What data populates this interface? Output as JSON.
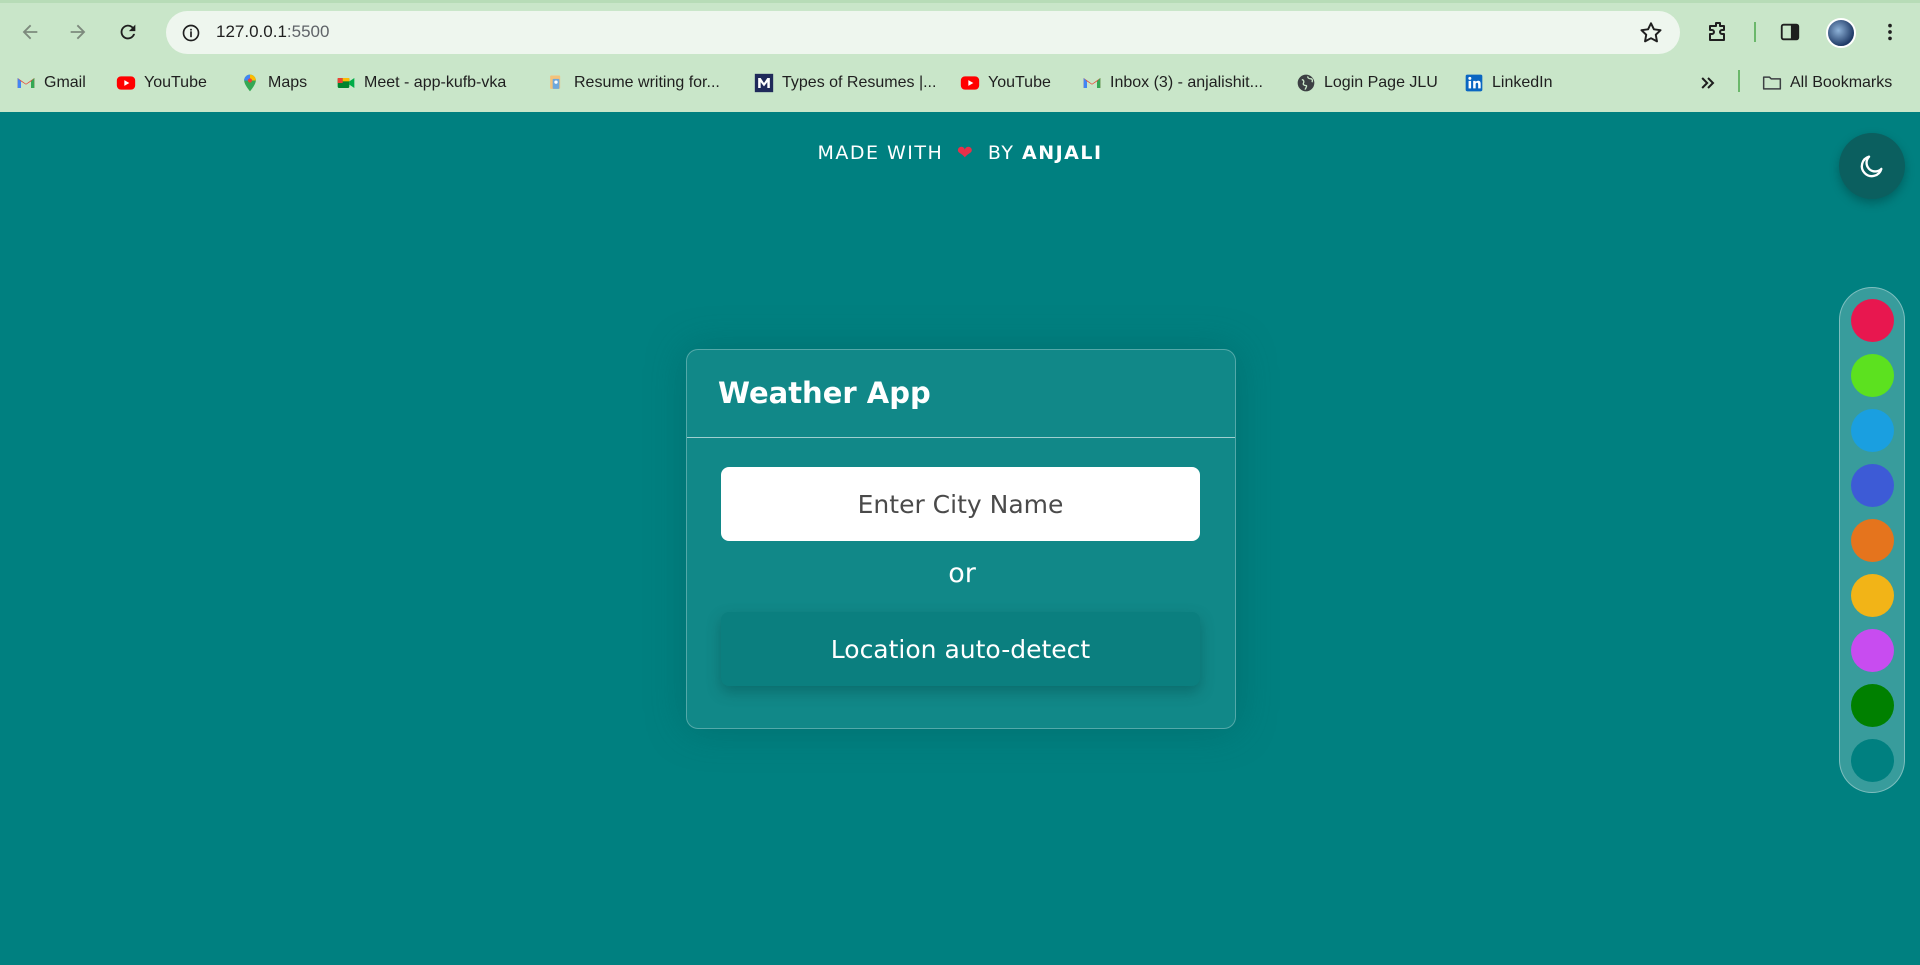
{
  "browser": {
    "url_host": "127.0.0.1",
    "url_port": ":5500",
    "bookmarks": [
      {
        "label": "Gmail",
        "icon": "gmail-icon"
      },
      {
        "label": "YouTube",
        "icon": "youtube-icon"
      },
      {
        "label": "Maps",
        "icon": "maps-icon"
      },
      {
        "label": "Meet - app-kufb-vka",
        "icon": "meet-icon"
      },
      {
        "label": "Resume writing for...",
        "icon": "resume-icon"
      },
      {
        "label": "Types of Resumes |...",
        "icon": "m-icon"
      },
      {
        "label": "YouTube",
        "icon": "youtube-icon"
      },
      {
        "label": "Inbox (3) - anjalishit...",
        "icon": "gmail-icon"
      },
      {
        "label": "Login Page JLU",
        "icon": "globe-icon"
      },
      {
        "label": "LinkedIn",
        "icon": "linkedin-icon"
      }
    ],
    "all_bookmarks_label": "All Bookmarks"
  },
  "page": {
    "made_with": "MADE WITH",
    "by": "BY",
    "author": "ANJALI",
    "app_title": "Weather App",
    "city_placeholder": "Enter City Name",
    "or_label": "or",
    "locate_button": "Location auto-detect"
  },
  "palette": {
    "colors": [
      "#e8174f",
      "#5ce11f",
      "#1a9fe0",
      "#3d5bd6",
      "#e5741d",
      "#f2b417",
      "#c84cf0",
      "#008000",
      "#008080"
    ]
  },
  "colors": {
    "background": "#008080",
    "card": "#118888",
    "chrome": "#c9e6c9"
  }
}
